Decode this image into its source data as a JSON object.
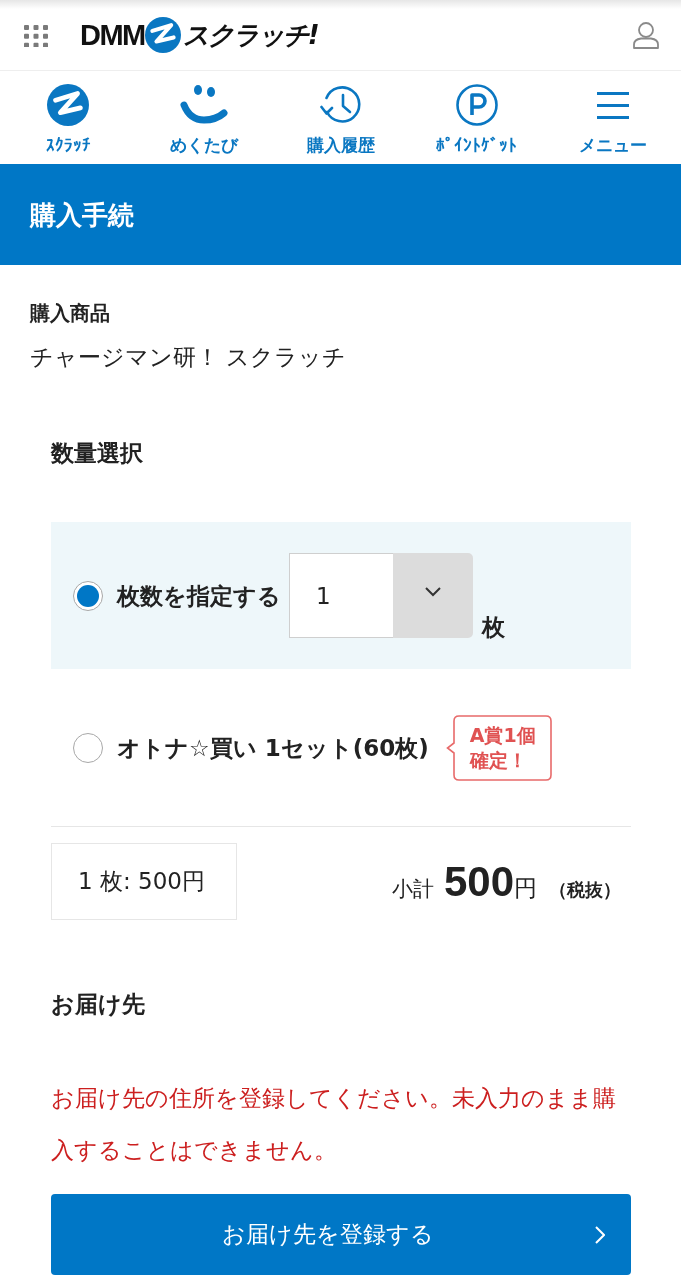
{
  "top_bar": {
    "logo": {
      "brand": "DMM",
      "name": "スクラッチ!"
    }
  },
  "nav": [
    {
      "label": "ｽｸﾗｯﾁ"
    },
    {
      "label": "めくたび"
    },
    {
      "label": "購入履歴"
    },
    {
      "label": "ﾎﾟｲﾝﾄｹﾞｯﾄ"
    },
    {
      "label": "メニュー"
    }
  ],
  "page_title": "購入手続",
  "product": {
    "label": "購入商品",
    "name": "チャージマン研！ スクラッチ"
  },
  "quantity": {
    "label": "数量選択",
    "options": [
      {
        "kind": "count",
        "label": "枚数を指定する",
        "selected": true,
        "select_value": "1",
        "unit": "枚"
      },
      {
        "kind": "set",
        "label": "オトナ☆買い 1セット(60枚)",
        "selected": false,
        "badge": [
          "A賞1個",
          "確定！"
        ]
      }
    ]
  },
  "price": {
    "unit_price": "1 枚: 500円",
    "subtotal_label": "小計",
    "subtotal_value": "500",
    "currency": "円",
    "tax_note": "（税抜）"
  },
  "delivery": {
    "label": "お届け先",
    "error": "お届け先の住所を登録してください。未入力のまま購入することはできません。",
    "button": "お届け先を登録する"
  }
}
